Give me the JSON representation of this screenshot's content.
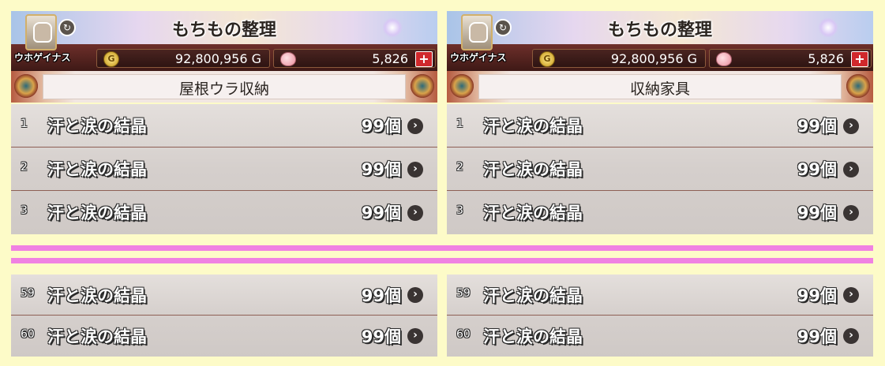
{
  "header": {
    "title": "もちもの整理",
    "player_name": "ウホゲイナス",
    "gold": "92,800,956 G",
    "gems": "5,826",
    "plus_label": "+"
  },
  "panels": [
    {
      "category": "屋根ウラ収納",
      "top_items": [
        {
          "index": "1",
          "name": "汗と涙の結晶",
          "qty": "99個"
        },
        {
          "index": "2",
          "name": "汗と涙の結晶",
          "qty": "99個"
        },
        {
          "index": "3",
          "name": "汗と涙の結晶",
          "qty": "99個"
        }
      ],
      "bottom_items": [
        {
          "index": "59",
          "name": "汗と涙の結晶",
          "qty": "99個"
        },
        {
          "index": "60",
          "name": "汗と涙の結晶",
          "qty": "99個"
        }
      ]
    },
    {
      "category": "収納家具",
      "top_items": [
        {
          "index": "1",
          "name": "汗と涙の結晶",
          "qty": "99個"
        },
        {
          "index": "2",
          "name": "汗と涙の結晶",
          "qty": "99個"
        },
        {
          "index": "3",
          "name": "汗と涙の結晶",
          "qty": "99個"
        }
      ],
      "bottom_items": [
        {
          "index": "59",
          "name": "汗と涙の結晶",
          "qty": "99個"
        },
        {
          "index": "60",
          "name": "汗と涙の結晶",
          "qty": "99個"
        }
      ]
    }
  ],
  "icons": {
    "coin": "coin-icon",
    "gem": "gem-icon",
    "chevron": "chevron-right-icon",
    "sync": "sync-icon"
  },
  "colors": {
    "background": "#fdfbc8",
    "divider": "#f081e2",
    "plus_button": "#d0282c"
  }
}
